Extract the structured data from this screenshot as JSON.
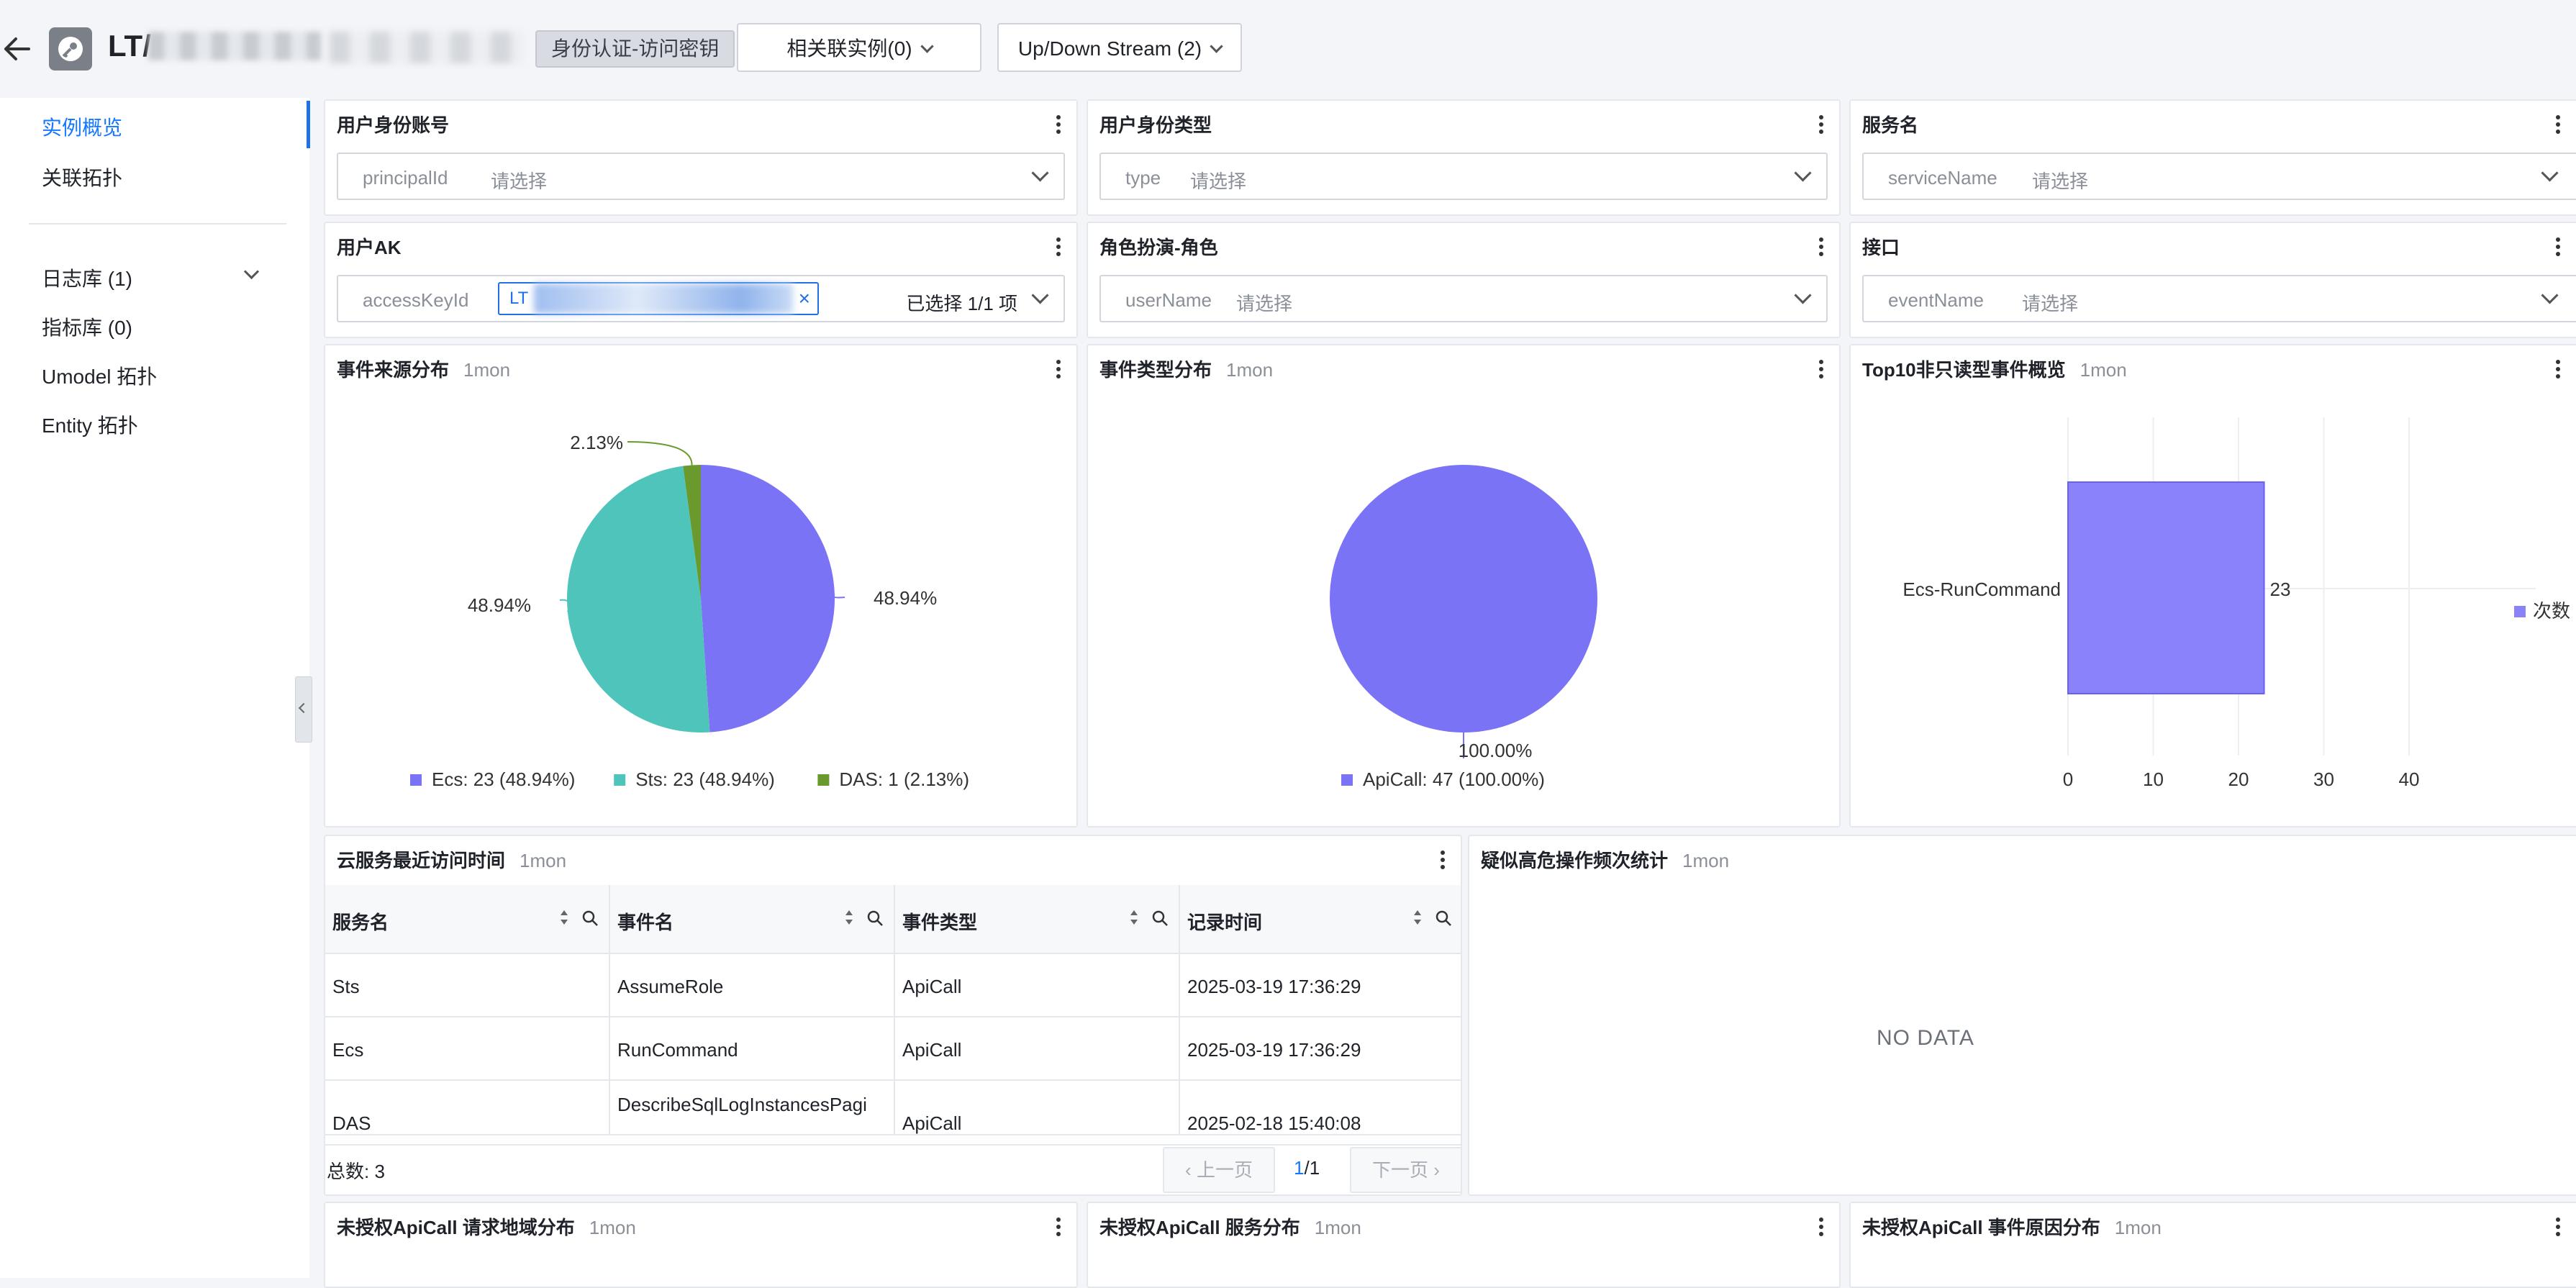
{
  "header": {
    "title": "LT/",
    "tag": "身份认证-访问密钥",
    "related_btn": "相关联实例(0)",
    "stream_btn": "Up/Down Stream (2)"
  },
  "sidebar": {
    "items": [
      {
        "label": "实例概览",
        "active": true
      },
      {
        "label": "关联拓扑"
      },
      {
        "label": "日志库 (1)"
      },
      {
        "label": "指标库 (0)"
      },
      {
        "label": "Umodel 拓扑"
      },
      {
        "label": "Entity 拓扑"
      }
    ]
  },
  "filters": {
    "principal": {
      "title": "用户身份账号",
      "key": "principalId",
      "placeholder": "请选择"
    },
    "type": {
      "title": "用户身份类型",
      "key": "type",
      "placeholder": "请选择"
    },
    "service": {
      "title": "服务名",
      "key": "serviceName",
      "placeholder": "请选择"
    },
    "ak": {
      "title": "用户AK",
      "key": "accessKeyId",
      "chip": "LT",
      "selected": "已选择 1/1 项"
    },
    "role": {
      "title": "角色扮演-角色",
      "key": "userName",
      "placeholder": "请选择"
    },
    "api": {
      "title": "接口",
      "key": "eventName",
      "placeholder": "请选择"
    }
  },
  "charts": {
    "source": {
      "title": "事件来源分布",
      "time": "1mon",
      "legend": [
        "Ecs: 23 (48.94%)",
        "Sts: 23 (48.94%)",
        "DAS: 1 (2.13%)"
      ],
      "labels": [
        "48.94%",
        "48.94%",
        "2.13%"
      ]
    },
    "type": {
      "title": "事件类型分布",
      "time": "1mon",
      "legend": [
        "ApiCall: 47 (100.00%)"
      ],
      "labels": [
        "100.00%"
      ]
    },
    "top10": {
      "title": "Top10非只读型事件概览",
      "time": "1mon",
      "category": "Ecs-RunCommand",
      "value_label": "23",
      "ticks": [
        "0",
        "10",
        "20",
        "30",
        "40"
      ],
      "legend": "次数"
    }
  },
  "chart_data": [
    {
      "type": "pie",
      "title": "事件来源分布",
      "categories": [
        "Ecs",
        "Sts",
        "DAS"
      ],
      "values": [
        23,
        23,
        1
      ],
      "percents": [
        48.94,
        48.94,
        2.13
      ],
      "colors": [
        "#7b73f6",
        "#4fc4bb",
        "#6a9a2e"
      ],
      "legend_position": "bottom"
    },
    {
      "type": "pie",
      "title": "事件类型分布",
      "categories": [
        "ApiCall"
      ],
      "values": [
        47
      ],
      "percents": [
        100.0
      ],
      "colors": [
        "#7b73f6"
      ],
      "legend_position": "bottom"
    },
    {
      "type": "bar",
      "title": "Top10非只读型事件概览",
      "orientation": "horizontal",
      "categories": [
        "Ecs-RunCommand"
      ],
      "series": [
        {
          "name": "次数",
          "values": [
            23
          ]
        }
      ],
      "xlim": [
        0,
        40
      ],
      "color": "#8a82f8",
      "legend_position": "right"
    }
  ],
  "recent": {
    "title": "云服务最近访问时间",
    "time": "1mon",
    "columns": [
      "服务名",
      "事件名",
      "事件类型",
      "记录时间"
    ],
    "rows": [
      [
        "Sts",
        "AssumeRole",
        "ApiCall",
        "2025-03-19 17:36:29"
      ],
      [
        "Ecs",
        "RunCommand",
        "ApiCall",
        "2025-03-19 17:36:29"
      ],
      [
        "DAS",
        "DescribeSqlLogInstancesPagi",
        "ApiCall",
        "2025-02-18 15:40:08"
      ]
    ],
    "total": "总数: 3",
    "prev": "上一页",
    "next": "下一页",
    "page": "1",
    "page_total": "/1"
  },
  "risk": {
    "title": "疑似高危操作频次统计",
    "time": "1mon",
    "empty": "NO DATA"
  },
  "bottom": [
    {
      "title": "未授权ApiCall 请求地域分布",
      "time": "1mon"
    },
    {
      "title": "未授权ApiCall 服务分布",
      "time": "1mon"
    },
    {
      "title": "未授权ApiCall 事件原因分布",
      "time": "1mon"
    }
  ]
}
